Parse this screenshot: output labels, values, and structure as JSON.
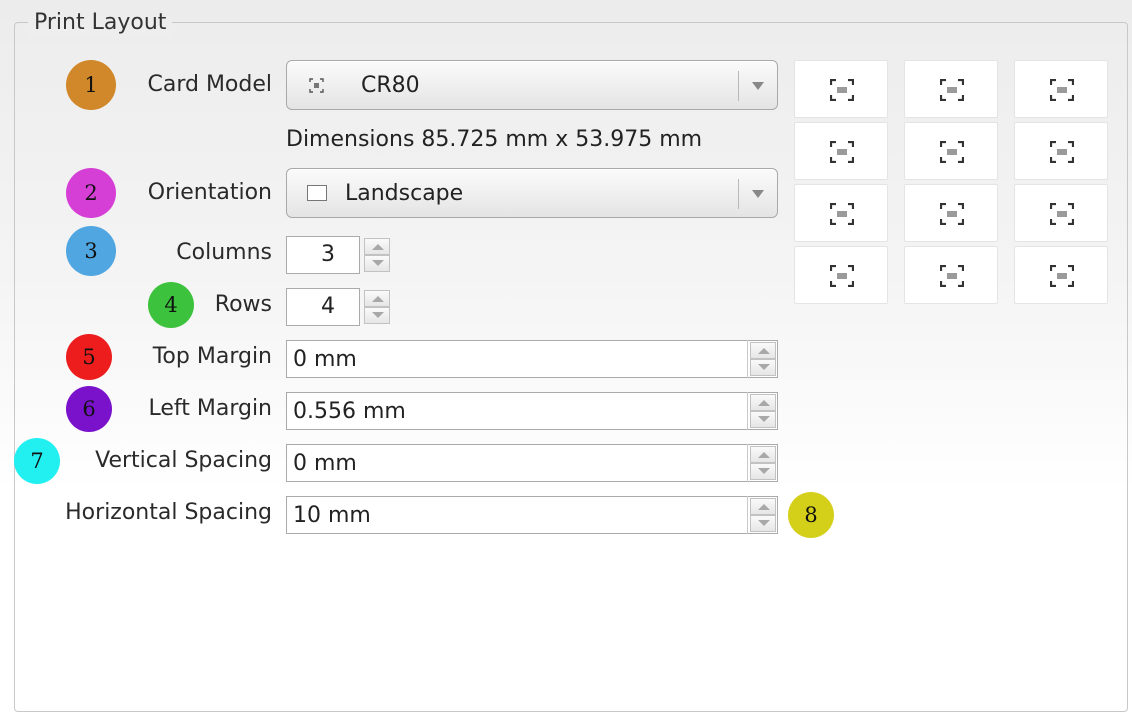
{
  "group": {
    "title": "Print Layout"
  },
  "badges": [
    "1",
    "2",
    "3",
    "4",
    "5",
    "6",
    "7",
    "8"
  ],
  "badge_colors": [
    "#d0882a",
    "#d63fd6",
    "#4fa6e0",
    "#3cc23c",
    "#ee1d1d",
    "#7a12cc",
    "#22f0f0",
    "#d4d01a"
  ],
  "card_model": {
    "label": "Card Model",
    "value": "CR80",
    "icon": "card-icon"
  },
  "dimensions": "Dimensions 85.725 mm x 53.975 mm",
  "orientation": {
    "label": "Orientation",
    "value": "Landscape",
    "icon": "landscape-icon"
  },
  "columns": {
    "label": "Columns",
    "value": "3"
  },
  "rows": {
    "label": "Rows",
    "value": "4"
  },
  "top_margin": {
    "label": "Top Margin",
    "value": "0 mm"
  },
  "left_margin": {
    "label": "Left Margin",
    "value": "0.556 mm"
  },
  "vertical_spacing": {
    "label": "Vertical Spacing",
    "value": "0 mm"
  },
  "horizontal_spacing": {
    "label": "Horizontal Spacing",
    "value": "10 mm"
  },
  "preview": {
    "columns": 3,
    "rows": 4,
    "card_icon": "card-icon"
  }
}
